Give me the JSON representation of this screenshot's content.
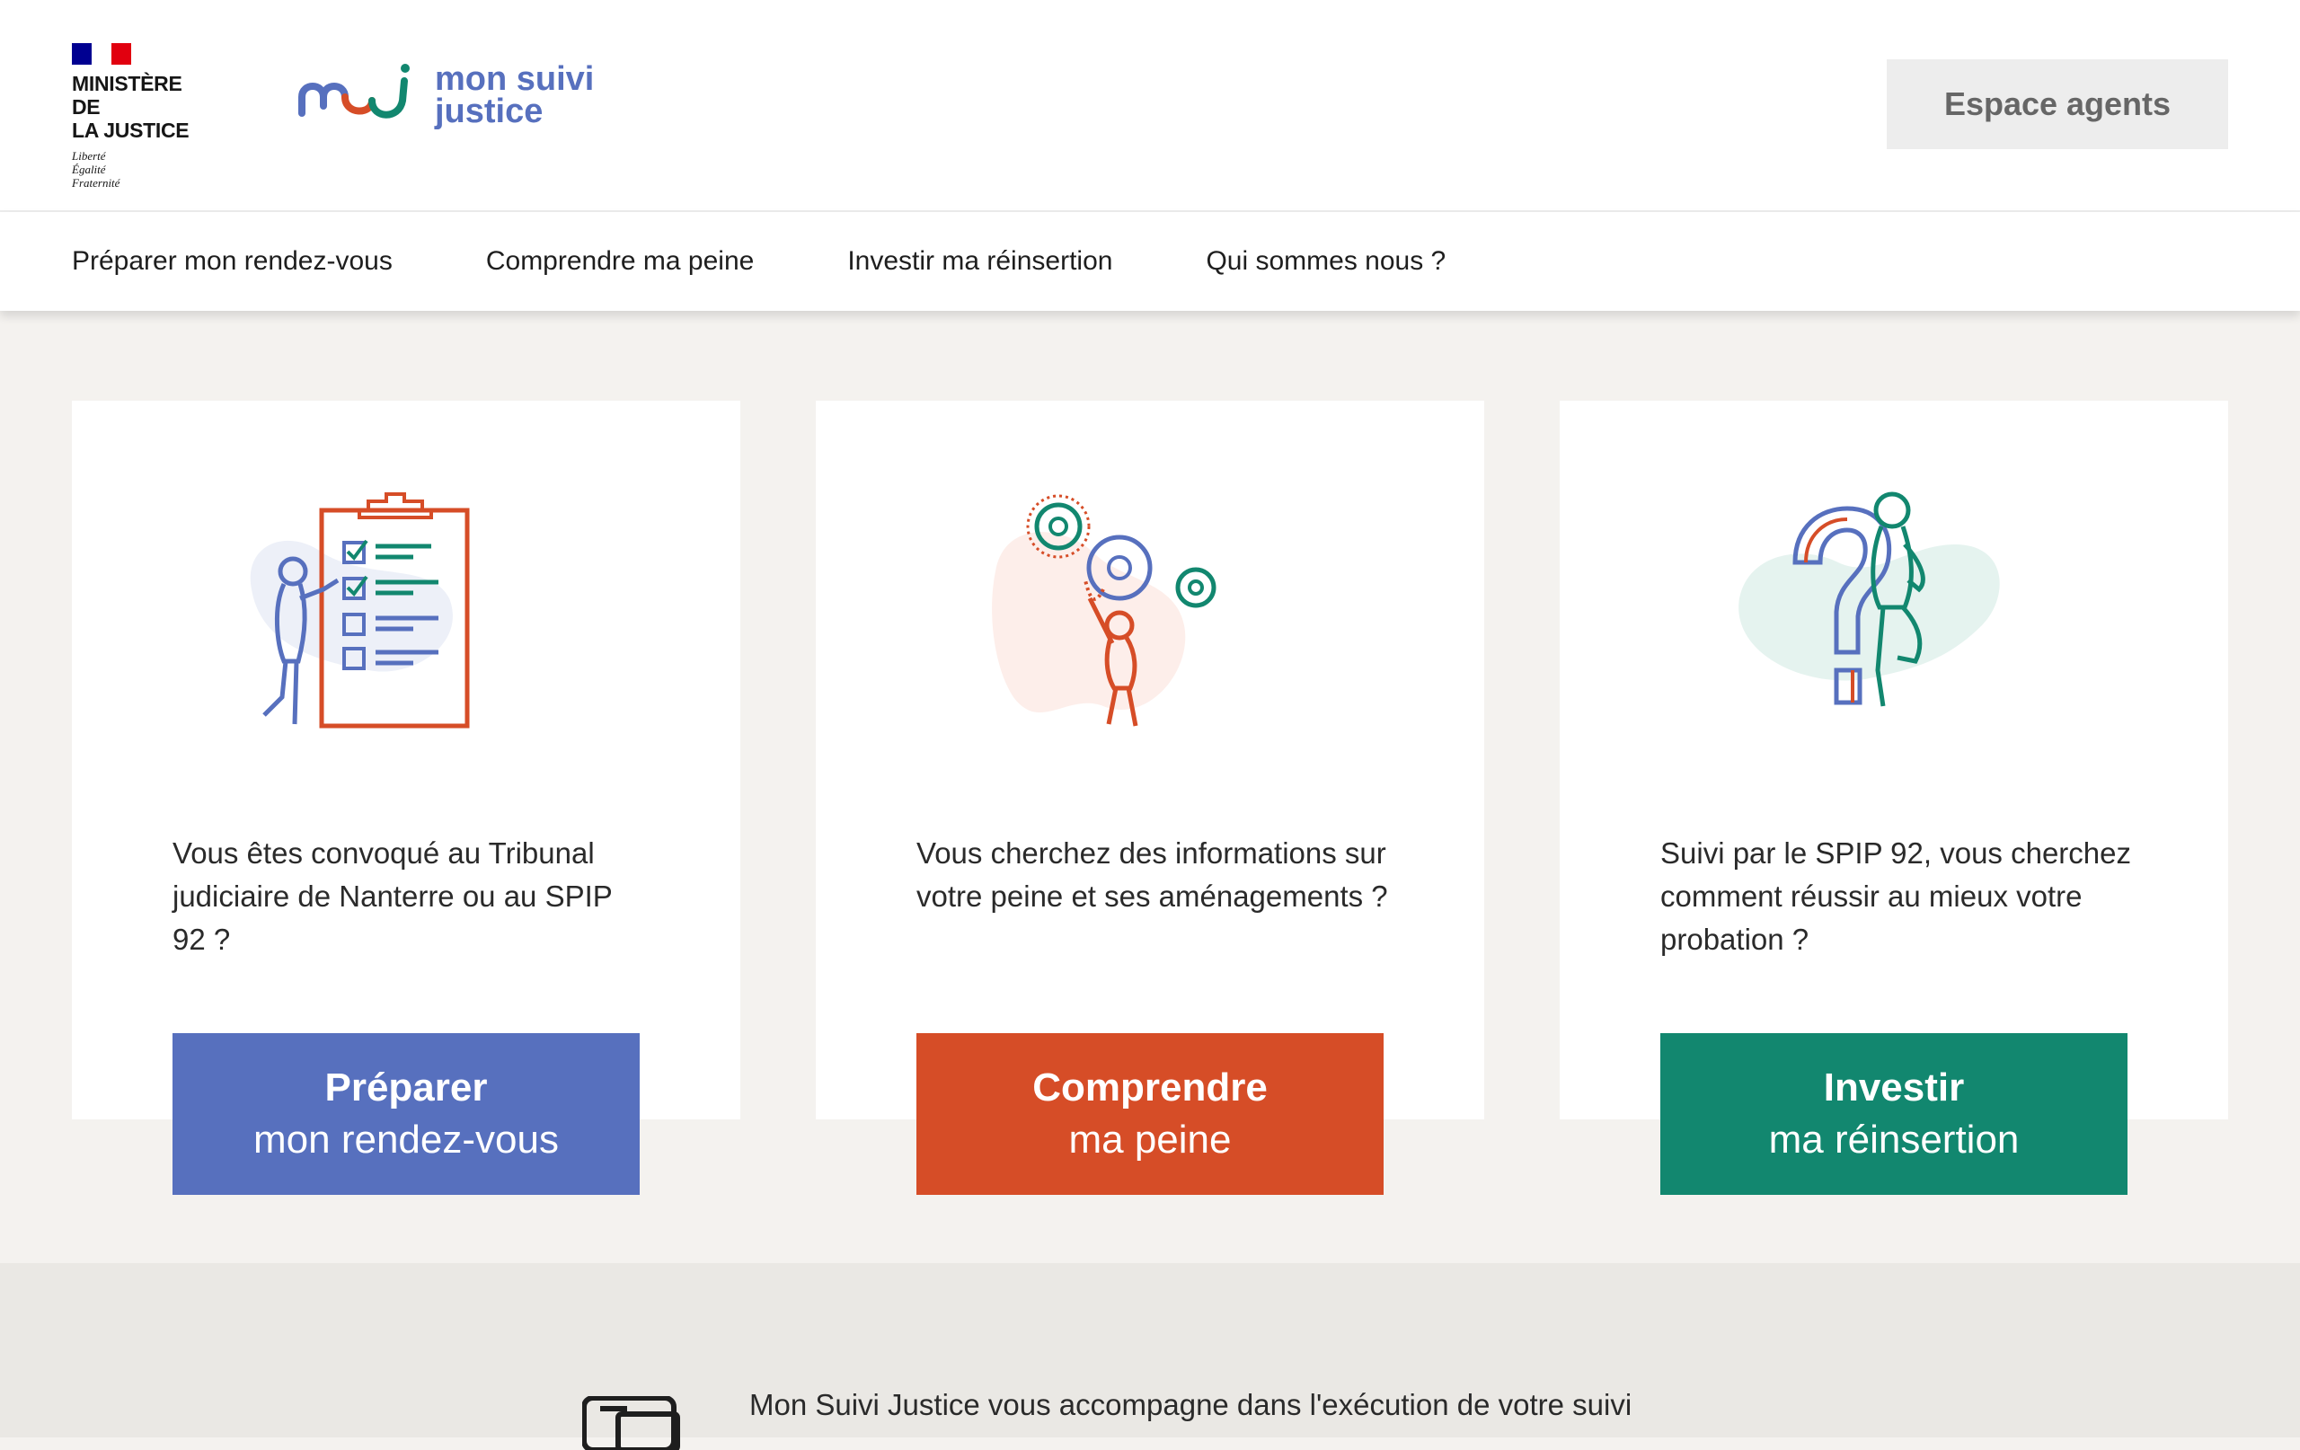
{
  "header": {
    "ministry_title_line1": "MINISTÈRE DE",
    "ministry_title_line2": "LA JUSTICE",
    "motto": [
      "Liberté",
      "Égalité",
      "Fraternité"
    ],
    "brand_line1": "mon suivi",
    "brand_line2": "justice",
    "agents_button": "Espace agents"
  },
  "nav": {
    "items": [
      {
        "label": "Préparer mon rendez-vous"
      },
      {
        "label": "Comprendre ma peine"
      },
      {
        "label": "Investir ma réinsertion"
      },
      {
        "label": "Qui sommes nous ?"
      }
    ]
  },
  "cards": [
    {
      "description": "Vous êtes convoqué au Tribunal judiciaire de Nanterre ou au SPIP 92 ?",
      "button_line1": "Préparer",
      "button_line2": "mon rendez-vous",
      "color": "#5770be",
      "icon": "clipboard-checklist-icon"
    },
    {
      "description": "Vous cherchez des informations sur votre peine et ses aménagements ?",
      "button_line1": "Comprendre",
      "button_line2": "ma peine",
      "color": "#d64d27",
      "icon": "gears-person-icon"
    },
    {
      "description": "Suivi par le SPIP 92, vous cherchez comment réussir au mieux votre probation ?",
      "button_line1": "Investir",
      "button_line2": "ma réinsertion",
      "color": "#12876f",
      "icon": "question-mark-person-icon"
    }
  ],
  "bottom": {
    "text": "Mon Suivi Justice vous accompagne dans l'exécution de votre suivi"
  },
  "colors": {
    "blue": "#5770be",
    "red": "#d64d27",
    "green": "#12876f",
    "flag_blue": "#000091",
    "flag_red": "#e1000f"
  }
}
